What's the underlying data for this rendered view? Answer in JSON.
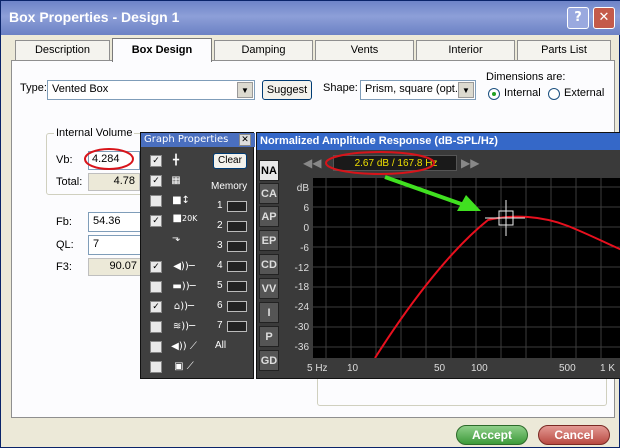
{
  "window": {
    "title": "Box Properties - Design 1"
  },
  "tabs": [
    "Description",
    "Box Design",
    "Damping",
    "Vents",
    "Interior",
    "Parts List"
  ],
  "active_tab": "Box Design",
  "form": {
    "type_label": "Type:",
    "type_value": "Vented Box",
    "suggest_label": "Suggest",
    "shape_label": "Shape:",
    "shape_value": "Prism, square (opt.)",
    "dimensions_label": "Dimensions are:",
    "dim_internal": "Internal",
    "dim_external": "External",
    "internal_volume_label": "Internal Volume",
    "vb_label": "Vb:",
    "vb_value": "4.284",
    "total_label": "Total:",
    "total_value": "4.78",
    "fb_label": "Fb:",
    "fb_value": "54.36",
    "ql_label": "QL:",
    "ql_value": "7",
    "f3_label": "F3:",
    "f3_value": "90.07"
  },
  "graph_properties": {
    "title": "Graph Properties",
    "clear_label": "Clear",
    "memory_label": "Memory",
    "memory_slots": [
      "1",
      "2",
      "3",
      "4",
      "5",
      "6",
      "7"
    ],
    "all_label": "All",
    "toggle_20k": "20K"
  },
  "graph": {
    "title": "Normalized Amplitude Response (dB-SPL/Hz)",
    "cursor_readout": "2.67 dB / 167.8 Hz",
    "side_tabs": [
      "NA",
      "CA",
      "AP",
      "EP",
      "CD",
      "VV",
      "I",
      "P",
      "GD"
    ],
    "y_unit": "dB",
    "y_ticks": [
      "6",
      "0",
      "-6",
      "-12",
      "-18",
      "-24",
      "-30",
      "-36"
    ],
    "x_ticks": [
      "5 Hz",
      "10",
      "50",
      "100",
      "500",
      "1 K"
    ],
    "curve_color": "#e8101e"
  },
  "footer": {
    "accept_label": "Accept",
    "cancel_label": "Cancel"
  }
}
